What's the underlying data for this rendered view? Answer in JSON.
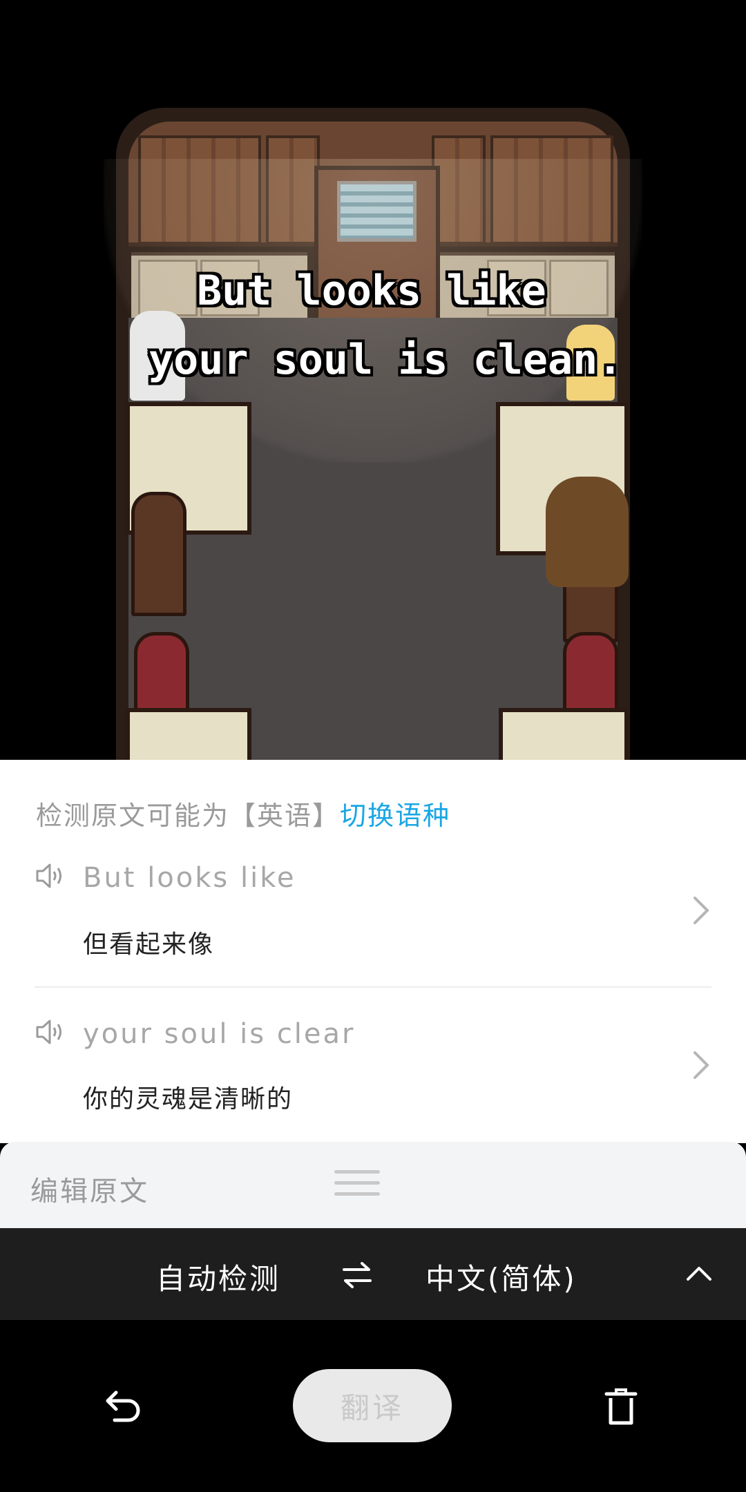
{
  "game": {
    "caption_line1": "But looks like",
    "caption_line2": "your soul is clean."
  },
  "detect": {
    "prefix": "检测原文可能为【英语】",
    "switch_label": "切换语种"
  },
  "results": [
    {
      "source": "But looks like",
      "translation": "但看起来像"
    },
    {
      "source": "your soul is clear",
      "translation": "你的灵魂是清晰的"
    }
  ],
  "edit": {
    "label": "编辑原文"
  },
  "language_bar": {
    "source_lang": "自动检测",
    "target_lang": "中文(简体)"
  },
  "actions": {
    "translate_label": "翻译"
  },
  "icons": [
    "speaker-icon",
    "chevron-right-icon",
    "drag-handle-icon",
    "swap-icon",
    "chevron-up-icon",
    "back-icon",
    "delete-icon"
  ],
  "colors": {
    "accent": "#1aa6e4",
    "lang_bar": "#1e1e1e",
    "edit_bar": "#f3f4f6"
  }
}
